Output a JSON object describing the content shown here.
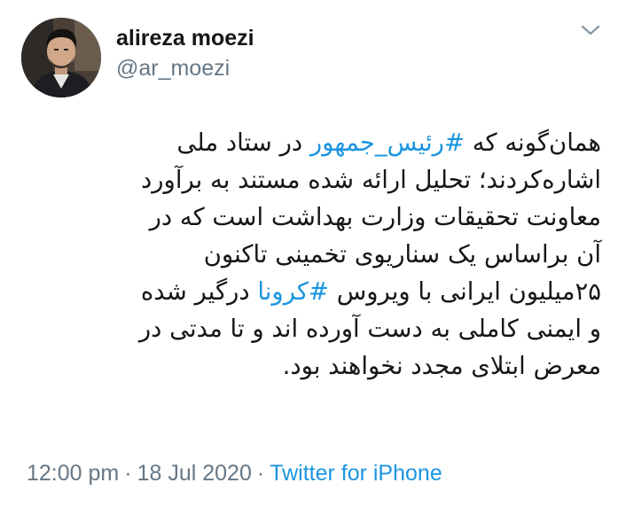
{
  "author": {
    "display_name": "alireza moezi",
    "handle": "@ar_moezi",
    "avatar_icon": "profile-photo"
  },
  "menu_icon": "chevron-down-icon",
  "tweet": {
    "lines": [
      [
        {
          "text": "همان‌گونه که "
        },
        {
          "text": "#رئیس_جمهور",
          "hashtag": true
        },
        {
          "text": " در ستاد ملی"
        }
      ],
      [
        {
          "text": "اشاره‌کردند؛ تحلیل ارائه شده مستند به برآورد"
        }
      ],
      [
        {
          "text": "معاونت تحقیقات وزارت بهداشت  است که در"
        }
      ],
      [
        {
          "text": "آن براساس یک سناریوی تخمینی  تاکنون"
        }
      ],
      [
        {
          "text": "۲۵میلیون ایرانی با ویروس "
        },
        {
          "text": "#کرونا",
          "hashtag": true
        },
        {
          "text": " درگیر شده"
        }
      ],
      [
        {
          "text": "و ایمنی کاملی به دست آورده اند و تا مدتی در"
        }
      ],
      [
        {
          "text": "معرض ابتلای مجدد نخواهند بود."
        }
      ]
    ]
  },
  "meta": {
    "time": "12:00 pm",
    "separator": "·",
    "date": "18 Jul 2020",
    "source": "Twitter for iPhone"
  },
  "colors": {
    "hashtag": "#1b95e0",
    "secondary_text": "#657786",
    "primary_text": "#14171a"
  }
}
